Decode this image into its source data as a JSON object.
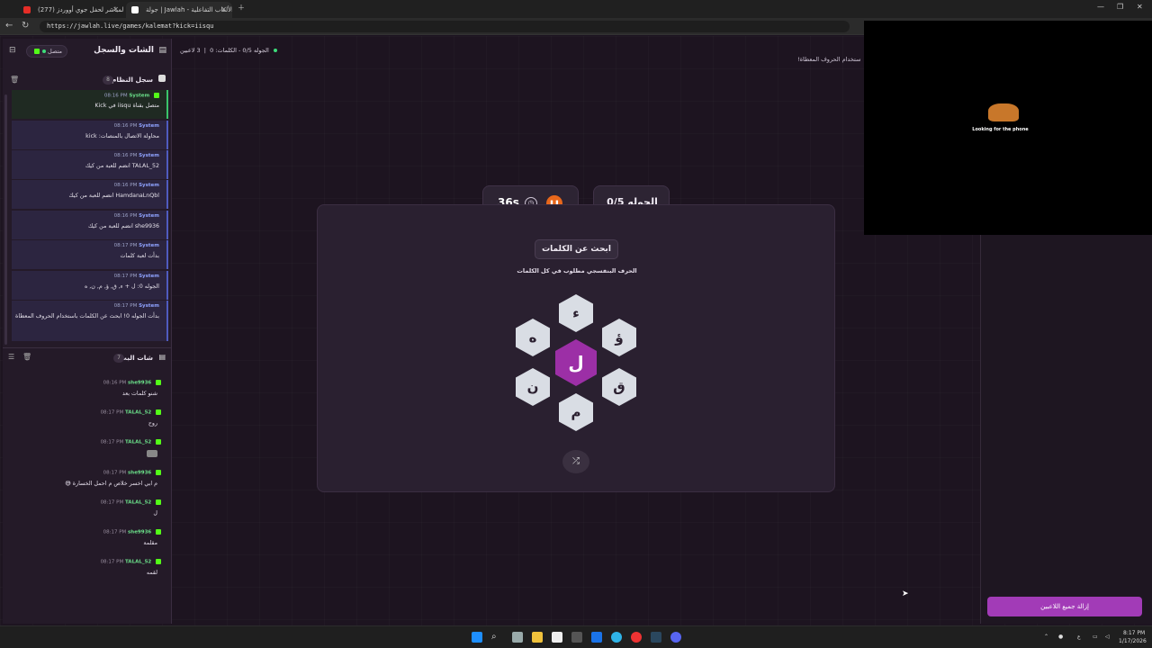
{
  "browser": {
    "tabs": [
      {
        "title": "(277) البث المباشر لحفل جوي أووردز"
      },
      {
        "title": "جولة | Jawlah - منصة الألعاب التفاعلية"
      }
    ],
    "url": "https://jawlah.live/games/kalemat?kick=iisqu"
  },
  "left_panel": {
    "title": "الشات والسجل",
    "status_label": "متصل",
    "system_log": {
      "title": "سجل النظام",
      "count": "8",
      "items": [
        {
          "sender": "System",
          "time": "08:16 PM",
          "text": "متصل بقناة iisqu في Kick"
        },
        {
          "sender": "System",
          "time": "08:16 PM",
          "text": "محاولة الاتصال بالمنصات: kick"
        },
        {
          "sender": "System",
          "time": "08:16 PM",
          "text": "TALAL_52 انضم للعبة من كيك"
        },
        {
          "sender": "System",
          "time": "08:16 PM",
          "text": "HamdanaLnQbl انضم للعبة من كيك"
        },
        {
          "sender": "System",
          "time": "08:16 PM",
          "text": "she9936 انضم للعبة من كيك"
        },
        {
          "sender": "System",
          "time": "08:17 PM",
          "text": "بدأت لعبة كلمات"
        },
        {
          "sender": "System",
          "time": "08:17 PM",
          "text": "الجوله 0: ل + ء, ق, ؤ, م, ن, ه"
        },
        {
          "sender": "System",
          "time": "08:17 PM",
          "text": "بدأت الجوله 0! ابحث عن الكلمات باستخدام الحروف المعطاة"
        }
      ]
    },
    "stream_chat": {
      "title": "شات البث",
      "count": "7",
      "items": [
        {
          "user": "she9936",
          "time": "08:16 PM",
          "text": "شنو كلمات بعد"
        },
        {
          "user": "TALAL_52",
          "time": "08:17 PM",
          "text": "روح"
        },
        {
          "user": "TALAL_52",
          "time": "08:17 PM",
          "text": ""
        },
        {
          "user": "she9936",
          "time": "08:17 PM",
          "text": "م ابي اخسر خلاص م احمل الخسارة 😅"
        },
        {
          "user": "TALAL_52",
          "time": "08:17 PM",
          "text": "ل"
        },
        {
          "user": "she9936",
          "time": "08:17 PM",
          "text": "مقلمة"
        },
        {
          "user": "TALAL_52",
          "time": "08:17 PM",
          "text": "لقمه"
        }
      ]
    }
  },
  "top_status": {
    "round_words": "الجوله 0/5 - الكلمات: 0",
    "players": "3 لاعبين",
    "hint_cut": "ستخدام الحروف المعطاة!"
  },
  "game": {
    "round_label": "الجوله 0/5",
    "timer": "36s",
    "prompt_title": "ابحث عن الكلمات",
    "prompt_sub": "الحرف البنفسجي مطلوب في كل الكلمات",
    "center_letter": "ل",
    "letters": {
      "top": "ء",
      "top_right": "ؤ",
      "bottom_right": "ق",
      "bottom": "م",
      "bottom_left": "ن",
      "top_left": "ه"
    }
  },
  "video": {
    "caption": "Looking for the phone"
  },
  "right_panel": {
    "kick_all_label": "إزالة جميع اللاعبين"
  },
  "taskbar": {
    "lang": "ع",
    "time": "8:17 PM",
    "date": "1/17/2026"
  },
  "colors": {
    "accent": "#9c2fa6",
    "kick_green": "#53fc18",
    "orange": "#e8671b"
  }
}
